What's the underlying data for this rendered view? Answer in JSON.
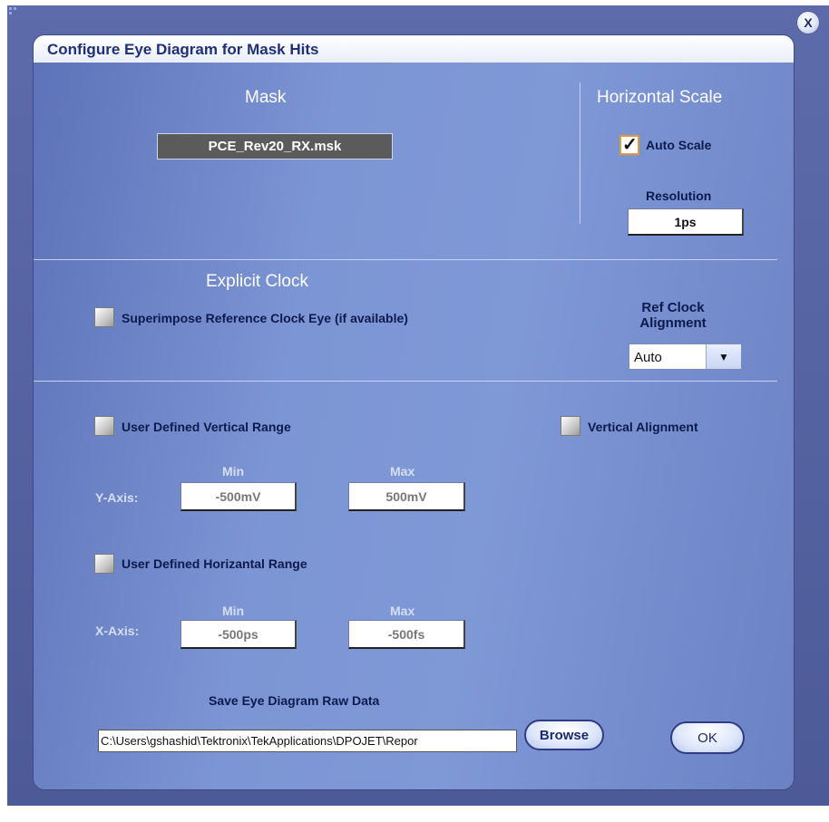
{
  "window": {
    "close_label": "X"
  },
  "dialog": {
    "title": "Configure Eye Diagram for Mask Hits"
  },
  "mask": {
    "heading": "Mask",
    "file": "PCE_Rev20_RX.msk"
  },
  "horizontal_scale": {
    "heading": "Horizontal Scale",
    "auto_scale_label": "Auto Scale",
    "auto_scale_checked": true,
    "check_glyph": "✓",
    "resolution_label": "Resolution",
    "resolution_value": "1ps"
  },
  "explicit_clock": {
    "heading": "Explicit Clock",
    "superimpose_label": "Superimpose Reference Clock Eye (if available)",
    "superimpose_checked": false,
    "ref_clock_label_1": "Ref Clock",
    "ref_clock_label_2": "Alignment",
    "ref_clock_value": "Auto",
    "dropdown_glyph": "▼"
  },
  "vertical": {
    "user_range_label": "User Defined Vertical Range",
    "user_range_checked": false,
    "alignment_label": "Vertical Alignment",
    "alignment_checked": false,
    "axis_label": "Y-Axis:",
    "min_label": "Min",
    "max_label": "Max",
    "min_value": "-500mV",
    "max_value": "500mV"
  },
  "horizontal": {
    "user_range_label": "User Defined Horizantal Range",
    "user_range_checked": false,
    "axis_label": "X-Axis:",
    "min_label": "Min",
    "max_label": "Max",
    "min_value": "-500ps",
    "max_value": "-500fs"
  },
  "save": {
    "label": "Save Eye Diagram Raw Data",
    "path": "C:\\Users\\gshashid\\Tektronix\\TekApplications\\DPOJET\\Repor",
    "browse_label": "Browse"
  },
  "ok_label": "OK",
  "colors": {
    "dialog_bg": "#7c95d4",
    "title_text": "#1f2f7a",
    "outer_bg": "#5d6bab",
    "checkbox_accent": "#e09a3a"
  }
}
